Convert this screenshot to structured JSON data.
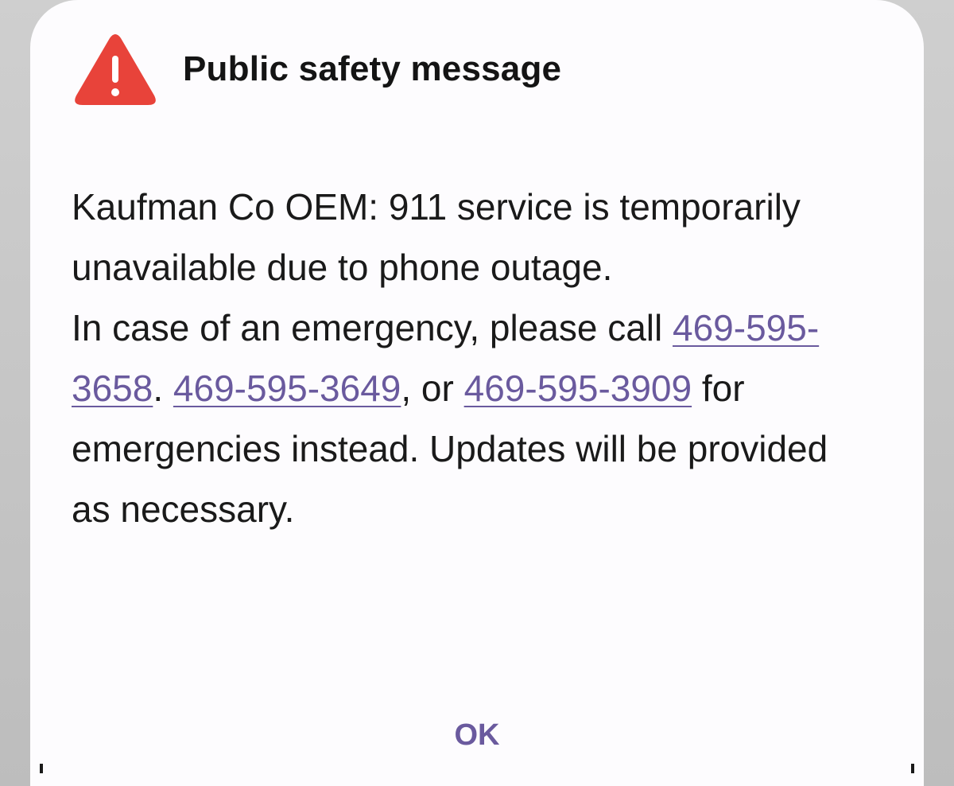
{
  "dialog": {
    "title": "Public safety message",
    "icon": "warning-triangle-icon",
    "icon_color": "#e8433a",
    "accent_color": "#6a5a9e",
    "message": {
      "line1": "Kaufman Co OEM: 911 service is temporarily unavailable due to phone outage.",
      "line2_prefix": "In case of an emergency, please call ",
      "phone1": "469-595-3658",
      "sep1": ". ",
      "phone2": "469-595-3649",
      "sep2": ", or ",
      "phone3": "469-595-3909",
      "suffix": " for emergencies instead. Updates will be provided as necessary."
    },
    "ok_label": "OK"
  }
}
